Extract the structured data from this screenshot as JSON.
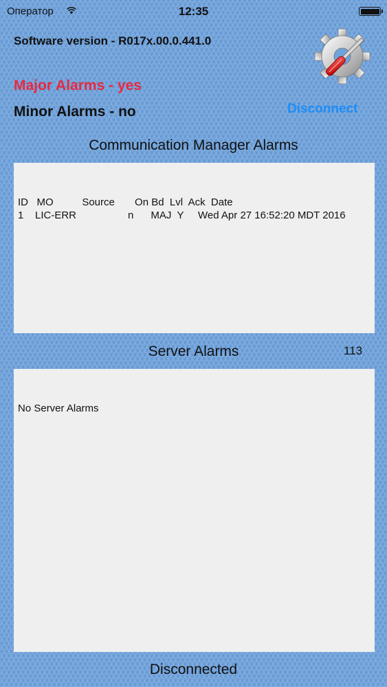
{
  "status_bar": {
    "carrier": "Оператор",
    "time": "12:35"
  },
  "header": {
    "software_version": "Software version - R017x.00.0.441.0",
    "major_alarms": "Major Alarms - yes",
    "minor_alarms": "Minor Alarms - no",
    "disconnect_label": "Disconnect"
  },
  "cm_alarms": {
    "title": "Communication Manager Alarms",
    "header_row": "ID   MO          Source       On Bd  Lvl  Ack  Date",
    "rows": [
      "1    LIC-ERR                  n      MAJ  Y     Wed Apr 27 16:52:20 MDT 2016"
    ]
  },
  "server_alarms": {
    "title": "Server Alarms",
    "count": "113",
    "message": "No Server Alarms"
  },
  "footer": {
    "connection_status": "Disconnected"
  },
  "colors": {
    "major": "#e8283f",
    "link": "#1e8cf5",
    "background": "#6fa3dc",
    "panel": "#efefef"
  }
}
